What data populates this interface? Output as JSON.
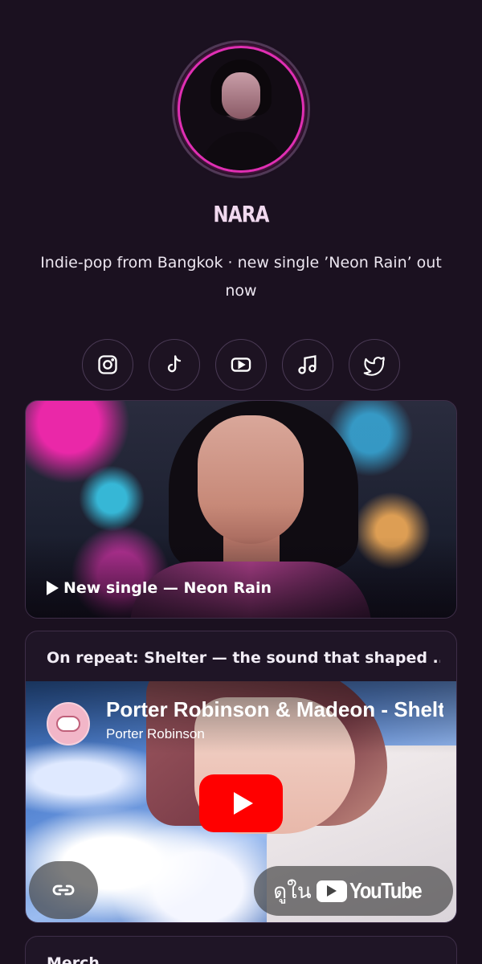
{
  "profile": {
    "name": "NARA",
    "bio": "Indie-pop from Bangkok · new single ’Neon Rain’ out now"
  },
  "socials": [
    {
      "icon": "instagram-icon"
    },
    {
      "icon": "tiktok-icon"
    },
    {
      "icon": "youtube-icon"
    },
    {
      "icon": "music-note-icon"
    },
    {
      "icon": "twitter-icon"
    }
  ],
  "feature": {
    "label": "New single — Neon Rain"
  },
  "video_card": {
    "title": "On repeat: Shelter — the sound that shaped ...",
    "video_title": "Porter Robinson & Madeon - Shelter",
    "channel": "Porter Robinson",
    "watch_on_prefix": "ดูใน",
    "watch_on_brand": "YouTube"
  },
  "merch": {
    "title": "Merch"
  },
  "colors": {
    "background": "#1b1120",
    "accent": "#e02fb3",
    "youtube_red": "#ff0000"
  }
}
